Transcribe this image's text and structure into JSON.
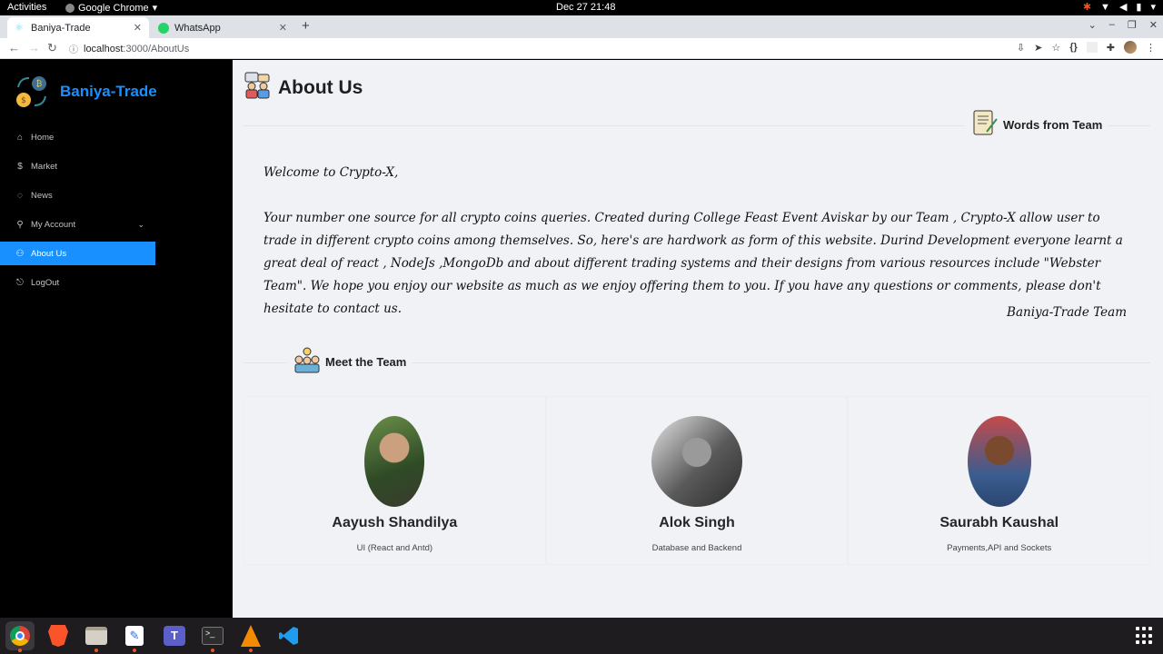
{
  "system": {
    "activities": "Activities",
    "app_menu": "Google Chrome",
    "clock": "Dec 27  21:48"
  },
  "browser": {
    "tabs": [
      {
        "title": "Baniya-Trade",
        "active": true
      },
      {
        "title": "WhatsApp",
        "active": false
      }
    ],
    "url_host": "localhost",
    "url_path": ":3000/AboutUs"
  },
  "sidebar": {
    "brand": "Baniya-Trade",
    "items": [
      {
        "label": "Home",
        "icon": "home-icon"
      },
      {
        "label": "Market",
        "icon": "dollar-icon"
      },
      {
        "label": "News",
        "icon": "bulb-icon"
      },
      {
        "label": "My Account",
        "icon": "user-icon"
      },
      {
        "label": "About Us",
        "icon": "team-icon",
        "active": true
      },
      {
        "label": "LogOut",
        "icon": "logout-icon"
      }
    ]
  },
  "about": {
    "title": "About Us",
    "words_title": "Words from Team",
    "greeting": "Welcome to Crypto-X,",
    "body": "Your number one source for all crypto coins queries. Created during College Feast Event Aviskar by our Team , Crypto-X allow user to trade in different crypto coins among themselves. So, here's are hardwork as form of this website. Durind Development everyone learnt a great deal of react , NodeJs ,MongoDb and about different trading systems and their designs from various resources include \"Webster Team\". We hope you enjoy our website as much as we enjoy offering them to you. If you have any questions or comments, please don't hesitate to contact us.",
    "signature": "Baniya-Trade Team",
    "team_title": "Meet the Team",
    "team": [
      {
        "name": "Aayush Shandilya",
        "role": "UI (React and Antd)"
      },
      {
        "name": "Alok Singh",
        "role": "Database and Backend"
      },
      {
        "name": "Saurabh Kaushal",
        "role": "Payments,API and Sockets"
      }
    ]
  },
  "colors": {
    "accent": "#1890ff",
    "sider": "#000000",
    "content_bg": "#f0f2f5"
  }
}
